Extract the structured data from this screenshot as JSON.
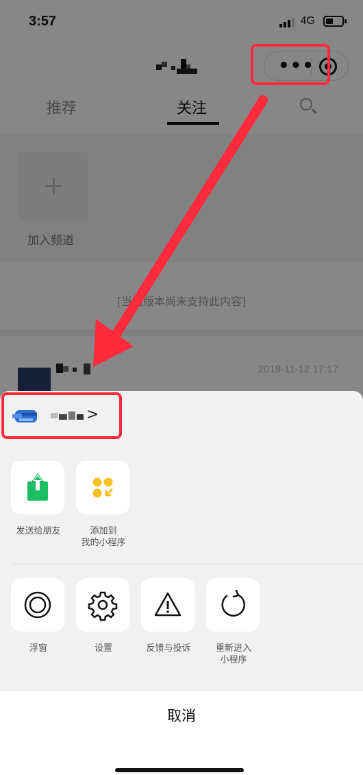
{
  "status_bar": {
    "time": "3:57",
    "network": "4G",
    "icons": [
      "signal-icon",
      "battery-icon"
    ]
  },
  "header": {
    "more_icon": "more-dots-icon",
    "close_icon": "target-close-icon"
  },
  "tabs": [
    {
      "label": "推荐",
      "active": false
    },
    {
      "label": "关注",
      "active": true
    }
  ],
  "search_icon": "search-icon",
  "channel": {
    "add_label": "加入频道"
  },
  "notice": "[当前版本尚未支持此内容]",
  "article": {
    "date": "2019-11-12 17:17"
  },
  "sheet": {
    "mp_chevron": ">",
    "row1": [
      {
        "label": "发送给朋友",
        "icon": "share-upload-icon"
      },
      {
        "label": "添加到\n我的小程序",
        "icon": "add-miniprogram-icon"
      }
    ],
    "row2": [
      {
        "label": "浮窗",
        "icon": "float-window-icon"
      },
      {
        "label": "设置",
        "icon": "gear-icon"
      },
      {
        "label": "反馈与投诉",
        "icon": "warning-icon"
      },
      {
        "label": "重新进入\n小程序",
        "icon": "reload-icon"
      }
    ],
    "cancel_label": "取消"
  },
  "colors": {
    "highlight": "#ff2b3d",
    "share_green": "#1dbd63",
    "miniprogram_yellow": "#f5c125"
  }
}
